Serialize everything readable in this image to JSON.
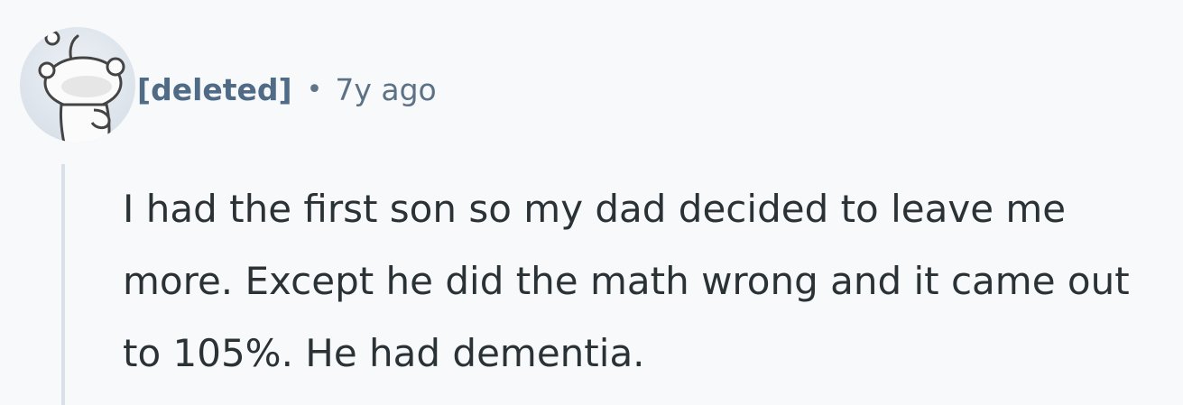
{
  "comment": {
    "author": "[deleted]",
    "separator": "•",
    "timestamp": "7y ago",
    "body": "I had the first son so my dad decided to leave me more. Except he did the math wrong and it came out to 105%. He had dementia."
  },
  "icons": {
    "avatar": "snoo-avatar-icon"
  }
}
